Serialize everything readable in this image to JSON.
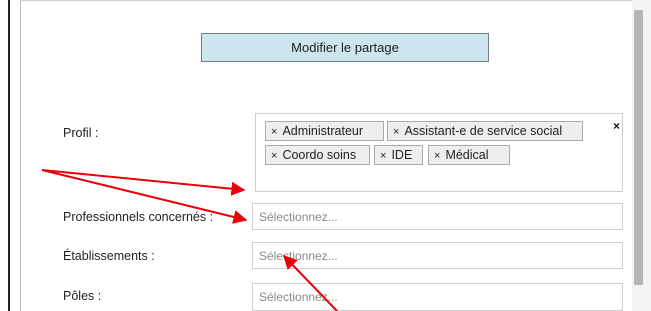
{
  "modify_button": {
    "label": "Modifier le partage"
  },
  "fields": {
    "profil": {
      "label": "Profil :"
    },
    "professionnels": {
      "label": "Professionnels concernés :",
      "placeholder": "Sélectionnez..."
    },
    "etablissements": {
      "label": "Établissements :",
      "placeholder": "Sélectionnez..."
    },
    "poles": {
      "label": "Pôles :",
      "placeholder": "Sélectionnez..."
    }
  },
  "profile_tags": [
    {
      "label": "Administrateur"
    },
    {
      "label": "Assistant-e de service social"
    },
    {
      "label": "Coordo soins"
    },
    {
      "label": "IDE"
    },
    {
      "label": "Médical"
    }
  ],
  "tag_remove_glyph": "×",
  "clear_all_glyph": "×",
  "annotation_color": "#e8000b"
}
